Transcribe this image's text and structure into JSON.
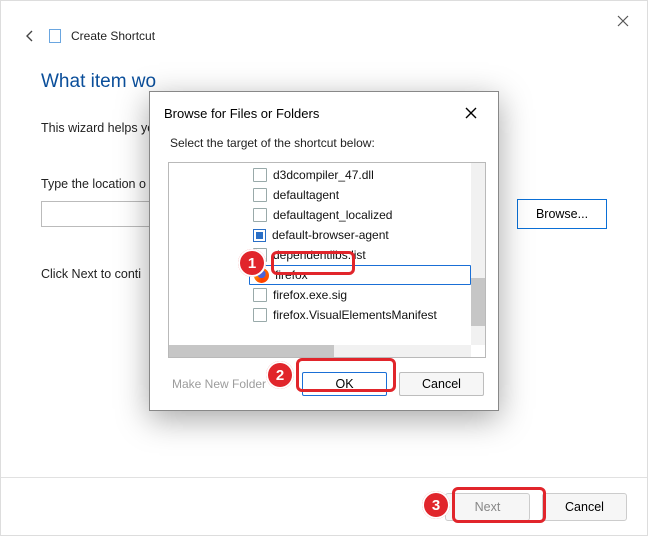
{
  "wizard": {
    "title": "Create Shortcut",
    "heading": "What item wo",
    "para": "This wizard helps you                                                                                                    folders, computers, or Internet addres",
    "location_label": "Type the location o",
    "browse_label": "Browse...",
    "continue_text": "Click Next to conti",
    "next_label": "Next",
    "cancel_label": "Cancel"
  },
  "modal": {
    "title": "Browse for Files or Folders",
    "subtitle": "Select the target of the shortcut below:",
    "make_folder_label": "Make New Folder",
    "ok_label": "OK",
    "cancel_label": "Cancel",
    "items": [
      {
        "icon": "page",
        "label": "d3dcompiler_47.dll"
      },
      {
        "icon": "page",
        "label": "defaultagent"
      },
      {
        "icon": "page",
        "label": "defaultagent_localized"
      },
      {
        "icon": "exe",
        "label": "default-browser-agent"
      },
      {
        "icon": "page",
        "label": "dependentlibs.list"
      },
      {
        "icon": "fox",
        "label": "firefox"
      },
      {
        "icon": "page",
        "label": "firefox.exe.sig"
      },
      {
        "icon": "page",
        "label": "firefox.VisualElementsManifest"
      }
    ],
    "selected_index": 5
  },
  "callouts": {
    "one": "1",
    "two": "2",
    "three": "3"
  }
}
